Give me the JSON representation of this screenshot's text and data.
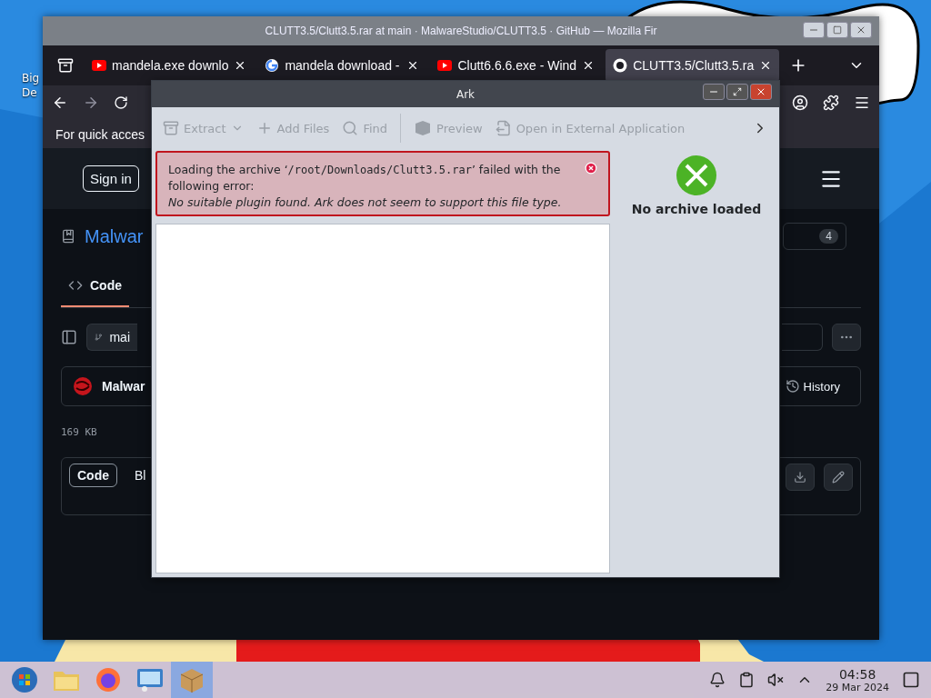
{
  "desktop": {
    "icon_label_lines": [
      "Big",
      "De"
    ]
  },
  "browser": {
    "title": "CLUTT3.5/Clutt3.5.rar at main · MalwareStudio/CLUTT3.5 · GitHub — Mozilla Fir",
    "tabs": [
      {
        "title": "mandela.exe downlo",
        "kind": "video",
        "selected": false
      },
      {
        "title": "mandela download -",
        "kind": "search",
        "selected": false
      },
      {
        "title": "Clutt6.6.6.exe - Wind",
        "kind": "video",
        "selected": false
      },
      {
        "title": "CLUTT3.5/Clutt3.5.ra",
        "kind": "code",
        "selected": true
      }
    ],
    "bookmarks_hint": "For quick acces",
    "page": {
      "sign_in": "Sign in",
      "repo_name": "Malwar",
      "count": "4",
      "nav_tab": "Code",
      "branch": "mai",
      "commit_author": "Malwar",
      "history": "History",
      "file_size": "169 KB",
      "view_tabs": [
        {
          "label": "Code",
          "selected": true
        },
        {
          "label": "Bl",
          "selected": false
        }
      ]
    }
  },
  "ark": {
    "title": "Ark",
    "toolbar": [
      {
        "label": "Extract",
        "kind": "menu",
        "disabled": true
      },
      {
        "label": "Add Files",
        "kind": "add",
        "disabled": true
      },
      {
        "label": "Find",
        "kind": "find",
        "disabled": true
      },
      {
        "label": "Preview",
        "kind": "preview",
        "disabled": true
      },
      {
        "label": "Open in External Application",
        "kind": "open",
        "disabled": true
      }
    ],
    "error": {
      "before": "Loading the archive ‘",
      "path": "/root/Downloads/Clutt3.5.rar",
      "after": "’ failed with the following error:",
      "detail": "No suitable plugin found. Ark does not seem to support this file type."
    },
    "info": "No archive loaded"
  },
  "taskbar": {
    "apps": [
      {
        "kind": "files",
        "selected": false
      },
      {
        "kind": "browser",
        "selected": false
      },
      {
        "kind": "settings",
        "selected": false
      },
      {
        "kind": "archiver",
        "selected": true
      }
    ],
    "time": "04:58",
    "date": "29 Mar 2024"
  }
}
